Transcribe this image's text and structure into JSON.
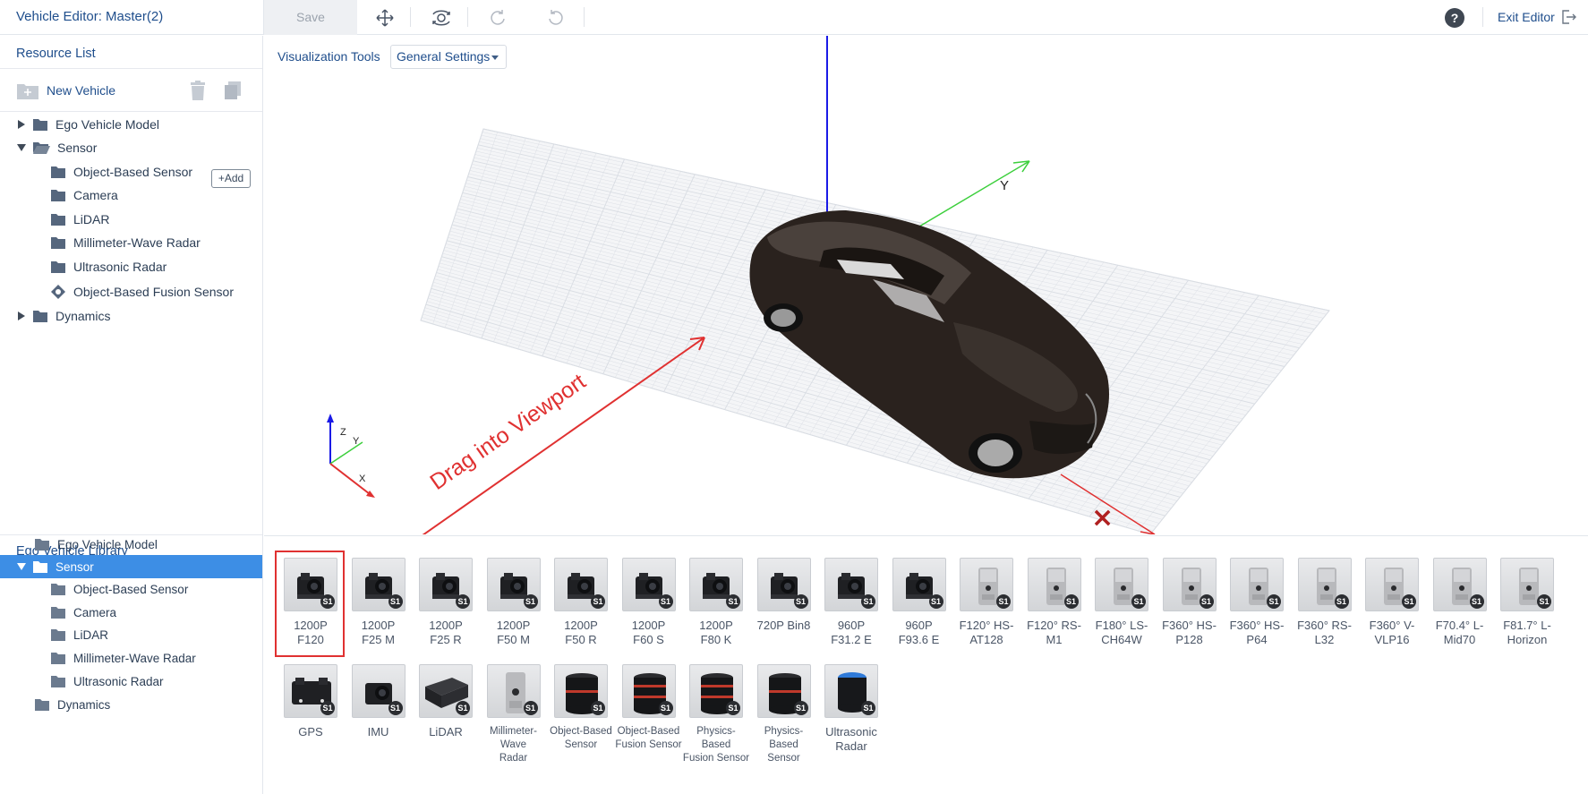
{
  "header": {
    "title": "Vehicle Editor: Master(2)",
    "save_label": "Save",
    "exit_label": "Exit Editor",
    "help_glyph": "?"
  },
  "resource_list": {
    "title": "Resource List",
    "new_vehicle_label": "New Vehicle",
    "add_label": "+Add",
    "tree": [
      {
        "label": "Ego Vehicle Model",
        "expanded": false
      },
      {
        "label": "Sensor",
        "expanded": true
      },
      {
        "label": "Object-Based Sensor"
      },
      {
        "label": "Camera"
      },
      {
        "label": "LiDAR"
      },
      {
        "label": "Millimeter-Wave Radar"
      },
      {
        "label": "Ultrasonic Radar"
      },
      {
        "label": "Object-Based Fusion Sensor"
      },
      {
        "label": "Dynamics",
        "expanded": false
      }
    ]
  },
  "viewport": {
    "tools_label": "Visualization Tools",
    "settings_label": "General Settings",
    "annotation": "Drag into Viewport",
    "axis_y_label": "Y",
    "gizmo": {
      "z": "Z",
      "y": "Y",
      "x": "X"
    },
    "colors": {
      "x_axis": "#e03131",
      "y_axis": "#3ccf3c",
      "z_axis": "#1a1ae6",
      "grid": "#d9dde3"
    }
  },
  "library": {
    "title": "Ego Vehicle Library",
    "tree": [
      {
        "label": "Ego Vehicle Model"
      },
      {
        "label": "Sensor",
        "selected": true
      },
      {
        "label": "Object-Based Sensor"
      },
      {
        "label": "Camera"
      },
      {
        "label": "LiDAR"
      },
      {
        "label": "Millimeter-Wave Radar"
      },
      {
        "label": "Ultrasonic Radar"
      },
      {
        "label": "Dynamics"
      }
    ],
    "badge": "S1",
    "items": [
      {
        "l1": "1200P",
        "l2": "F120",
        "icon": "camera-icon"
      },
      {
        "l1": "1200P",
        "l2": "F25 M",
        "icon": "camera-icon"
      },
      {
        "l1": "1200P",
        "l2": "F25 R",
        "icon": "camera-icon"
      },
      {
        "l1": "1200P",
        "l2": "F50 M",
        "icon": "camera-icon"
      },
      {
        "l1": "1200P",
        "l2": "F50 R",
        "icon": "camera-icon"
      },
      {
        "l1": "1200P",
        "l2": "F60 S",
        "icon": "camera-icon"
      },
      {
        "l1": "1200P",
        "l2": "F80 K",
        "icon": "camera-icon"
      },
      {
        "l1": "720P Bin8",
        "l2": "",
        "icon": "camera-icon"
      },
      {
        "l1": "960P",
        "l2": "F31.2 E",
        "icon": "camera-icon"
      },
      {
        "l1": "960P",
        "l2": "F93.6 E",
        "icon": "camera-icon"
      },
      {
        "l1": "F120° HS-",
        "l2": "AT128",
        "icon": "lidar-unit-icon"
      },
      {
        "l1": "F120° RS-",
        "l2": "M1",
        "icon": "lidar-unit-icon"
      },
      {
        "l1": "F180° LS-",
        "l2": "CH64W",
        "icon": "lidar-unit-icon"
      },
      {
        "l1": "F360° HS-",
        "l2": "P128",
        "icon": "lidar-unit-icon"
      },
      {
        "l1": "F360° HS-",
        "l2": "P64",
        "icon": "lidar-unit-icon"
      },
      {
        "l1": "F360° RS-",
        "l2": "L32",
        "icon": "lidar-unit-icon"
      },
      {
        "l1": "F360° V-",
        "l2": "VLP16",
        "icon": "lidar-unit-icon"
      },
      {
        "l1": "F70.4° L-",
        "l2": "Mid70",
        "icon": "lidar-unit-icon"
      },
      {
        "l1": "F81.7° L-",
        "l2": "Horizon",
        "icon": "lidar-unit-icon"
      },
      {
        "l1": "GPS",
        "l2": "",
        "icon": "gps-icon"
      },
      {
        "l1": "IMU",
        "l2": "",
        "icon": "imu-icon"
      },
      {
        "l1": "LiDAR",
        "l2": "",
        "icon": "lidar-box-icon"
      },
      {
        "l1": "Millimeter-Wave",
        "l2": "Radar",
        "icon": "radar-icon",
        "small": true
      },
      {
        "l1": "Object-Based",
        "l2": "Sensor",
        "icon": "cylinder-sensor-icon",
        "small": true
      },
      {
        "l1": "Object-Based",
        "l2": "Fusion Sensor",
        "icon": "cylinder-fusion-icon",
        "small": true
      },
      {
        "l1": "Physics-Based",
        "l2": "Fusion Sensor",
        "icon": "cylinder-fusion-icon",
        "small": true
      },
      {
        "l1": "Physics-Based",
        "l2": "Sensor",
        "icon": "cylinder-sensor-icon",
        "small": true
      },
      {
        "l1": "Ultrasonic",
        "l2": "Radar",
        "icon": "ultrasonic-icon"
      }
    ]
  }
}
